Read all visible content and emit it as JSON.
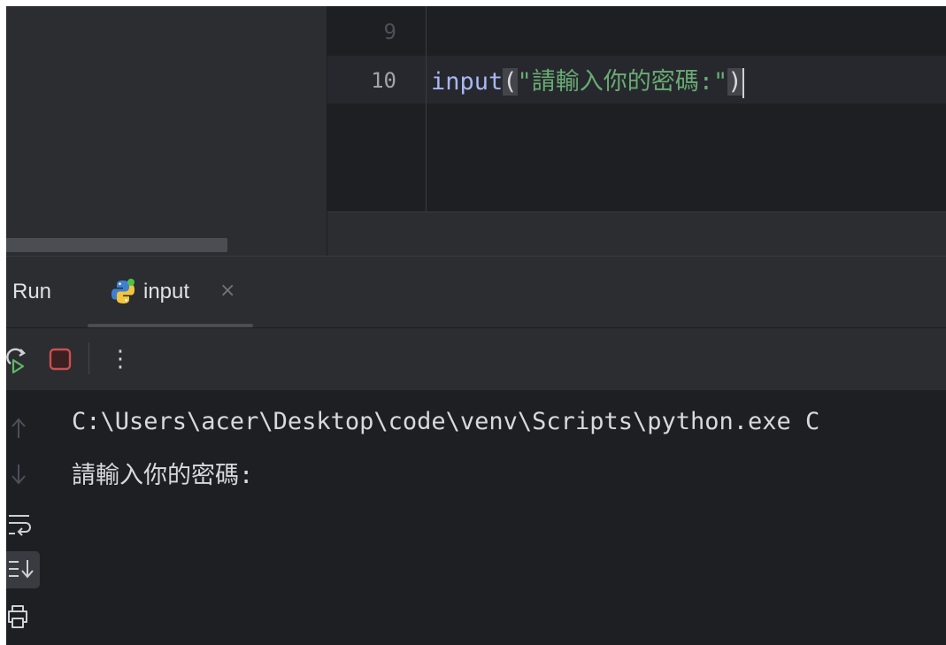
{
  "editor": {
    "lines": [
      {
        "number": "9",
        "code": ""
      },
      {
        "number": "10",
        "fn": "input",
        "open_paren": "(",
        "string": "\"請輸入你的密碼:\"",
        "close_paren": ")"
      }
    ]
  },
  "run_panel": {
    "title": "Run",
    "tab": {
      "label": "input",
      "close": "×",
      "icon": "python-icon"
    },
    "toolbar": {
      "rerun": "rerun-icon",
      "stop": "stop-icon",
      "more": "⋮"
    },
    "sidebar_icons": [
      "up-arrow-icon",
      "down-arrow-icon",
      "soft-wrap-icon",
      "scroll-to-end-icon",
      "print-icon"
    ],
    "console": {
      "lines": [
        "C:\\Users\\acer\\Desktop\\code\\venv\\Scripts\\python.exe C",
        "請輸入你的密碼:"
      ]
    }
  },
  "colors": {
    "background": "#1e1f22",
    "panel": "#2b2d30",
    "function": "#a9b7f2",
    "string": "#6aab73",
    "text": "#d7d9dc",
    "stop": "#c94f4f",
    "rerun": "#5fb865"
  }
}
